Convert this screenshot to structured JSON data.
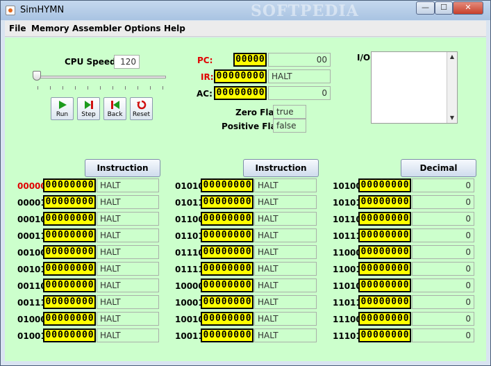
{
  "window": {
    "title": "SimHYMN",
    "watermark": "SOFTPEDIA",
    "minimize": "—",
    "maximize": "☐",
    "close": "✕"
  },
  "menu": [
    "File",
    "Memory",
    "Assembler",
    "Options",
    "Help"
  ],
  "cpu": {
    "speed_label": "CPU Speed:",
    "speed_value": "120",
    "speed_level": 0
  },
  "controls": [
    {
      "label": "Run",
      "icon": "play-icon"
    },
    {
      "label": "Step",
      "icon": "step-icon"
    },
    {
      "label": "Back",
      "icon": "back-icon"
    },
    {
      "label": "Reset",
      "icon": "reset-icon"
    }
  ],
  "registers": {
    "pc_label": "PC:",
    "pc_bits": "00000",
    "pc_value": "00",
    "ir_label": "IR:",
    "ir_bits": "00000000",
    "ir_value": "HALT",
    "ac_label": "AC:",
    "ac_bits": "00000000",
    "ac_value": "0",
    "zero_flag_label": "Zero Flag:",
    "zero_flag_value": "true",
    "positive_flag_label": "Positive Flag:",
    "positive_flag_value": "false"
  },
  "io": {
    "label": "I/O:",
    "content": ""
  },
  "memory": {
    "columns": [
      {
        "header": "Instruction",
        "rows": [
          {
            "addr": "00000",
            "bits": "00000000",
            "value": "HALT"
          },
          {
            "addr": "00001",
            "bits": "00000000",
            "value": "HALT"
          },
          {
            "addr": "00010",
            "bits": "00000000",
            "value": "HALT"
          },
          {
            "addr": "00011",
            "bits": "00000000",
            "value": "HALT"
          },
          {
            "addr": "00100",
            "bits": "00000000",
            "value": "HALT"
          },
          {
            "addr": "00101",
            "bits": "00000000",
            "value": "HALT"
          },
          {
            "addr": "00110",
            "bits": "00000000",
            "value": "HALT"
          },
          {
            "addr": "00111",
            "bits": "00000000",
            "value": "HALT"
          },
          {
            "addr": "01000",
            "bits": "00000000",
            "value": "HALT"
          },
          {
            "addr": "01001",
            "bits": "00000000",
            "value": "HALT"
          }
        ]
      },
      {
        "header": "Instruction",
        "rows": [
          {
            "addr": "01010",
            "bits": "00000000",
            "value": "HALT"
          },
          {
            "addr": "01011",
            "bits": "00000000",
            "value": "HALT"
          },
          {
            "addr": "01100",
            "bits": "00000000",
            "value": "HALT"
          },
          {
            "addr": "01101",
            "bits": "00000000",
            "value": "HALT"
          },
          {
            "addr": "01110",
            "bits": "00000000",
            "value": "HALT"
          },
          {
            "addr": "01111",
            "bits": "00000000",
            "value": "HALT"
          },
          {
            "addr": "10000",
            "bits": "00000000",
            "value": "HALT"
          },
          {
            "addr": "10001",
            "bits": "00000000",
            "value": "HALT"
          },
          {
            "addr": "10010",
            "bits": "00000000",
            "value": "HALT"
          },
          {
            "addr": "10011",
            "bits": "00000000",
            "value": "HALT"
          }
        ]
      },
      {
        "header": "Decimal",
        "rows": [
          {
            "addr": "10100",
            "bits": "00000000",
            "value": "0"
          },
          {
            "addr": "10101",
            "bits": "00000000",
            "value": "0"
          },
          {
            "addr": "10110",
            "bits": "00000000",
            "value": "0"
          },
          {
            "addr": "10111",
            "bits": "00000000",
            "value": "0"
          },
          {
            "addr": "11000",
            "bits": "00000000",
            "value": "0"
          },
          {
            "addr": "11001",
            "bits": "00000000",
            "value": "0"
          },
          {
            "addr": "11010",
            "bits": "00000000",
            "value": "0"
          },
          {
            "addr": "11011",
            "bits": "00000000",
            "value": "0"
          },
          {
            "addr": "11100",
            "bits": "00000000",
            "value": "0"
          },
          {
            "addr": "11101",
            "bits": "00000000",
            "value": "0"
          }
        ]
      }
    ],
    "current_address": "00000"
  },
  "colors": {
    "panel_bg": "#ccffcc",
    "bit_bg": "#ffff00",
    "highlight_red": "#e00000"
  }
}
